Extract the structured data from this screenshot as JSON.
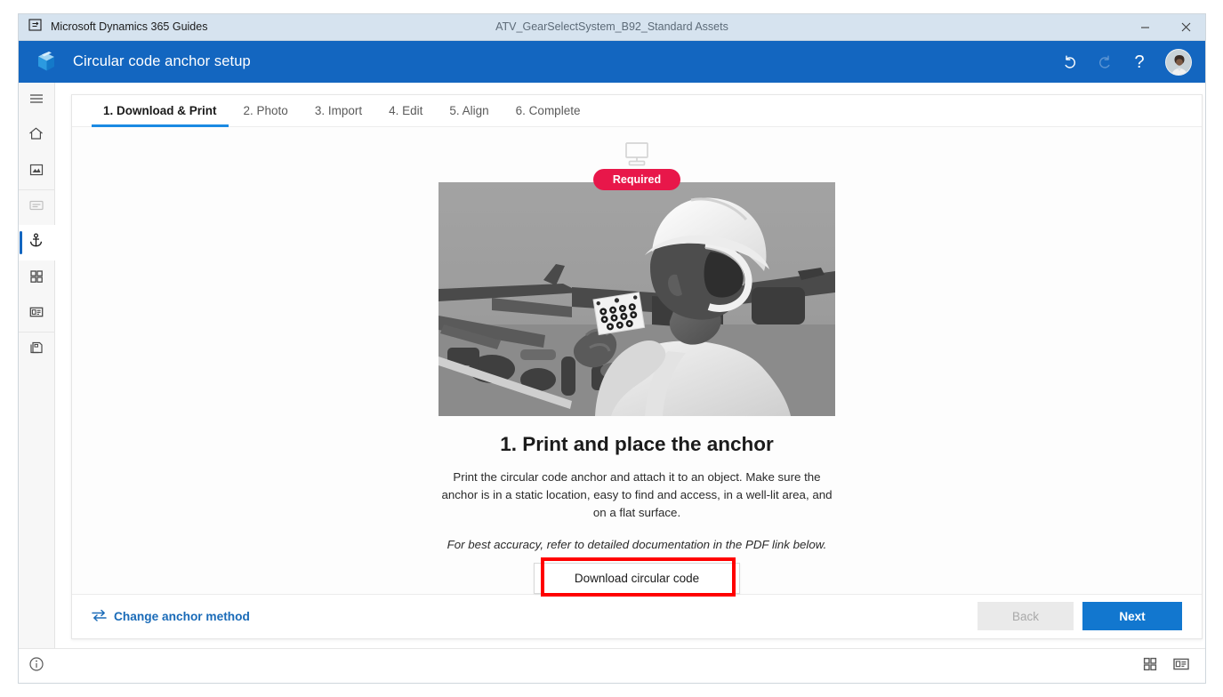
{
  "titlebar": {
    "app_name": "Microsoft Dynamics 365 Guides",
    "app_icon": "guides-app-icon",
    "document_title": "ATV_GearSelectSystem_B92_Standard Assets",
    "minimize_label": "—",
    "close_label": "✕"
  },
  "header": {
    "logo_icon": "dynamics-365-guides-logo",
    "title": "Circular code anchor setup",
    "undo_icon": "undo-icon",
    "redo_icon": "redo-icon",
    "help_icon": "help-question-icon",
    "help_label": "?",
    "avatar_icon": "user-avatar"
  },
  "sidebar": {
    "items": [
      {
        "icon": "hamburger-menu-icon",
        "name": "menu",
        "state": "normal"
      },
      {
        "icon": "home-icon",
        "name": "home",
        "state": "normal"
      },
      {
        "icon": "image-icon",
        "name": "media",
        "state": "normal"
      },
      {
        "icon": "text-card-icon",
        "name": "steps",
        "state": "disabled"
      },
      {
        "icon": "anchor-icon",
        "name": "anchor",
        "state": "selected"
      },
      {
        "icon": "grid-icon",
        "name": "parts",
        "state": "normal"
      },
      {
        "icon": "card-icon",
        "name": "properties",
        "state": "normal"
      },
      {
        "icon": "layers-copy-icon",
        "name": "assets",
        "state": "normal"
      }
    ]
  },
  "tabs": [
    {
      "label": "1. Download & Print",
      "active": true
    },
    {
      "label": "2. Photo",
      "active": false
    },
    {
      "label": "3. Import",
      "active": false
    },
    {
      "label": "4. Edit",
      "active": false
    },
    {
      "label": "5. Align",
      "active": false
    },
    {
      "label": "6. Complete",
      "active": false
    }
  ],
  "main": {
    "device_icon": "desktop-monitor-icon",
    "badge_label": "Required",
    "badge_color": "#e8174a",
    "illustration_alt": "Worker in hard hat placing circular code anchor card on a vehicle frame",
    "step_title": "1. Print and place the anchor",
    "step_description": "Print the circular code anchor and attach it to an object. Make sure the anchor is in a static location, easy to find and access, in a well-lit area, and on a flat surface.",
    "step_note": "For best accuracy, refer to detailed documentation in the PDF link below.",
    "download_button_label": "Download circular code",
    "highlight_color": "#ff0000"
  },
  "footer": {
    "change_anchor_icon": "swap-arrows-icon",
    "change_anchor_label": "Change anchor method",
    "back_label": "Back",
    "back_disabled": true,
    "next_label": "Next",
    "next_color": "#1277cf"
  },
  "statusbar": {
    "info_icon": "info-circle-icon",
    "grid_view_icon": "grid-view-icon",
    "detail_view_icon": "detail-view-icon"
  }
}
